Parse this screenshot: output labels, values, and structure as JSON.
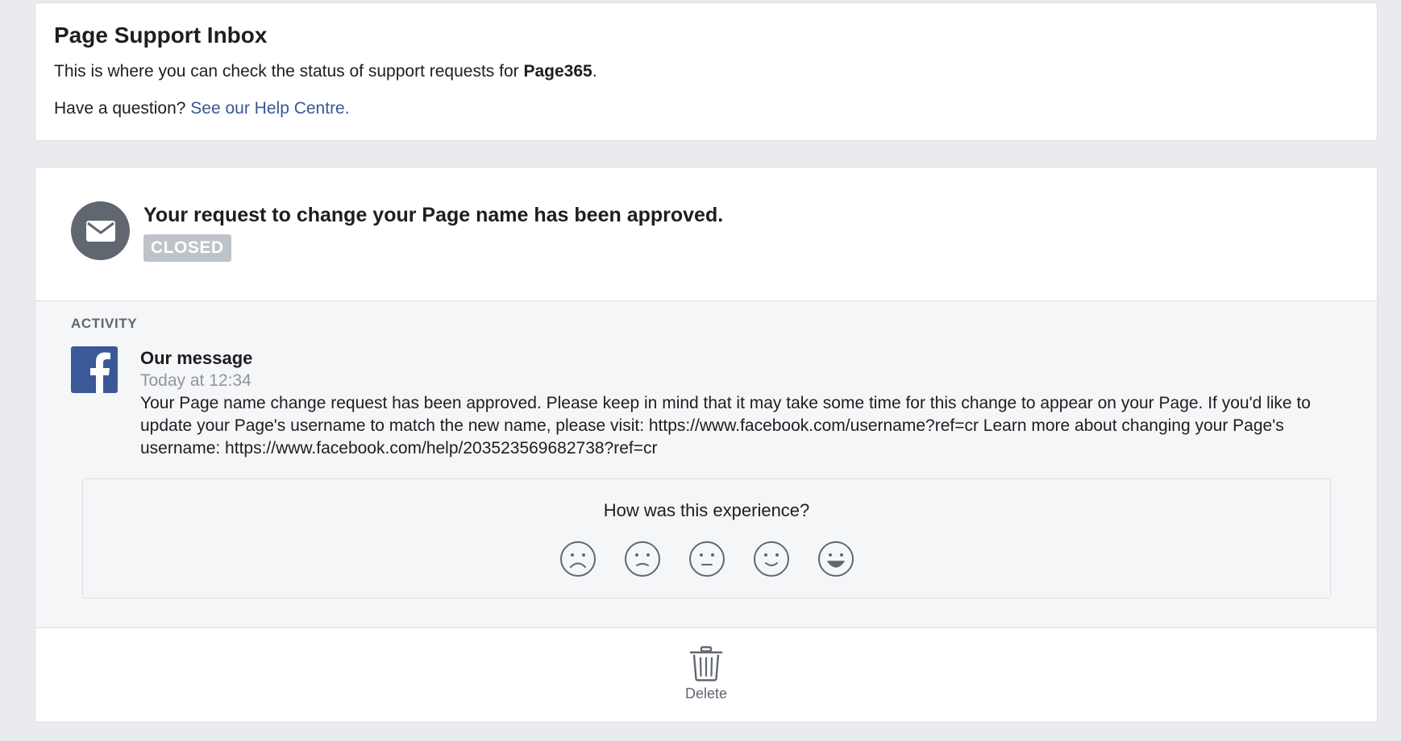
{
  "header": {
    "title": "Page Support Inbox",
    "intro": "This is where you can check the status of support requests for ",
    "page_name": "Page365",
    "intro_end": ".",
    "question": "Have a question? ",
    "help_link": "See our Help Centre."
  },
  "request": {
    "icon": "envelope-icon",
    "title": "Your request to change your Page name has been approved.",
    "status": "CLOSED"
  },
  "activity": {
    "label": "ACTIVITY",
    "message": {
      "icon": "facebook-logo",
      "title": "Our message",
      "time": "Today at 12:34",
      "body": "Your Page name change request has been approved. Please keep in mind that it may take some time for this change to appear on your Page. If you'd like to update your Page's username to match the new name, please visit: https://www.facebook.com/username?ref=cr Learn more about changing your Page's username: https://www.facebook.com/help/203523569682738?ref=cr"
    },
    "feedback": {
      "question": "How was this experience?",
      "options": [
        "very-sad-face-icon",
        "sad-face-icon",
        "neutral-face-icon",
        "smile-face-icon",
        "big-smile-face-icon"
      ]
    }
  },
  "footer": {
    "delete_label": "Delete",
    "delete_icon": "trash-icon"
  },
  "colors": {
    "background": "#e9ebee",
    "link": "#385898",
    "facebook_blue": "#3b5998",
    "badge_gray": "#bec3c9"
  }
}
